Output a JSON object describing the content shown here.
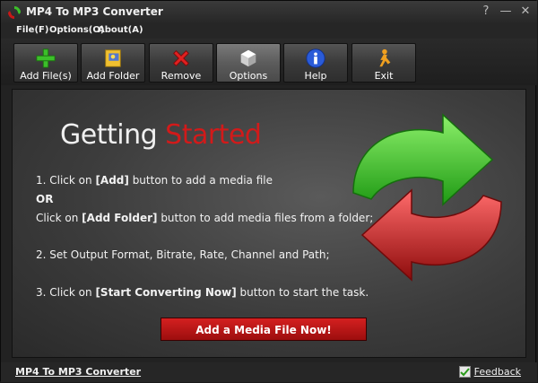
{
  "window": {
    "title": "MP4 To MP3 Converter"
  },
  "titlebar_buttons": {
    "help": "?",
    "minimize": "—",
    "close": "✕"
  },
  "menu": {
    "file": "File(F)",
    "options": "Options(O)",
    "about": "About(A)"
  },
  "toolbar": {
    "add_files": "Add File(s)",
    "add_folder": "Add Folder",
    "remove": "Remove",
    "options": "Options",
    "help": "Help",
    "exit": "Exit"
  },
  "main": {
    "heading_part1": "Getting ",
    "heading_part2": "Started",
    "step1_prefix": "1. Click on ",
    "step1_bold": "[Add]",
    "step1_suffix": " button to add a media file",
    "or": "OR",
    "step1b_prefix": "Click on ",
    "step1b_bold": "[Add Folder]",
    "step1b_suffix": " button to add media files from a folder;",
    "step2": "2. Set Output Format, Bitrate, Rate, Channel and Path;",
    "step3_prefix": "3. Click on ",
    "step3_bold": "[Start Converting Now]",
    "step3_suffix": " button to start the task.",
    "cta": "Add a Media File Now!"
  },
  "statusbar": {
    "left_link": "MP4 To MP3 Converter",
    "feedback": "Feedback"
  },
  "colors": {
    "accent_red": "#d21a1a",
    "arrow_green": "#3cbf2a",
    "arrow_red": "#c81818"
  }
}
